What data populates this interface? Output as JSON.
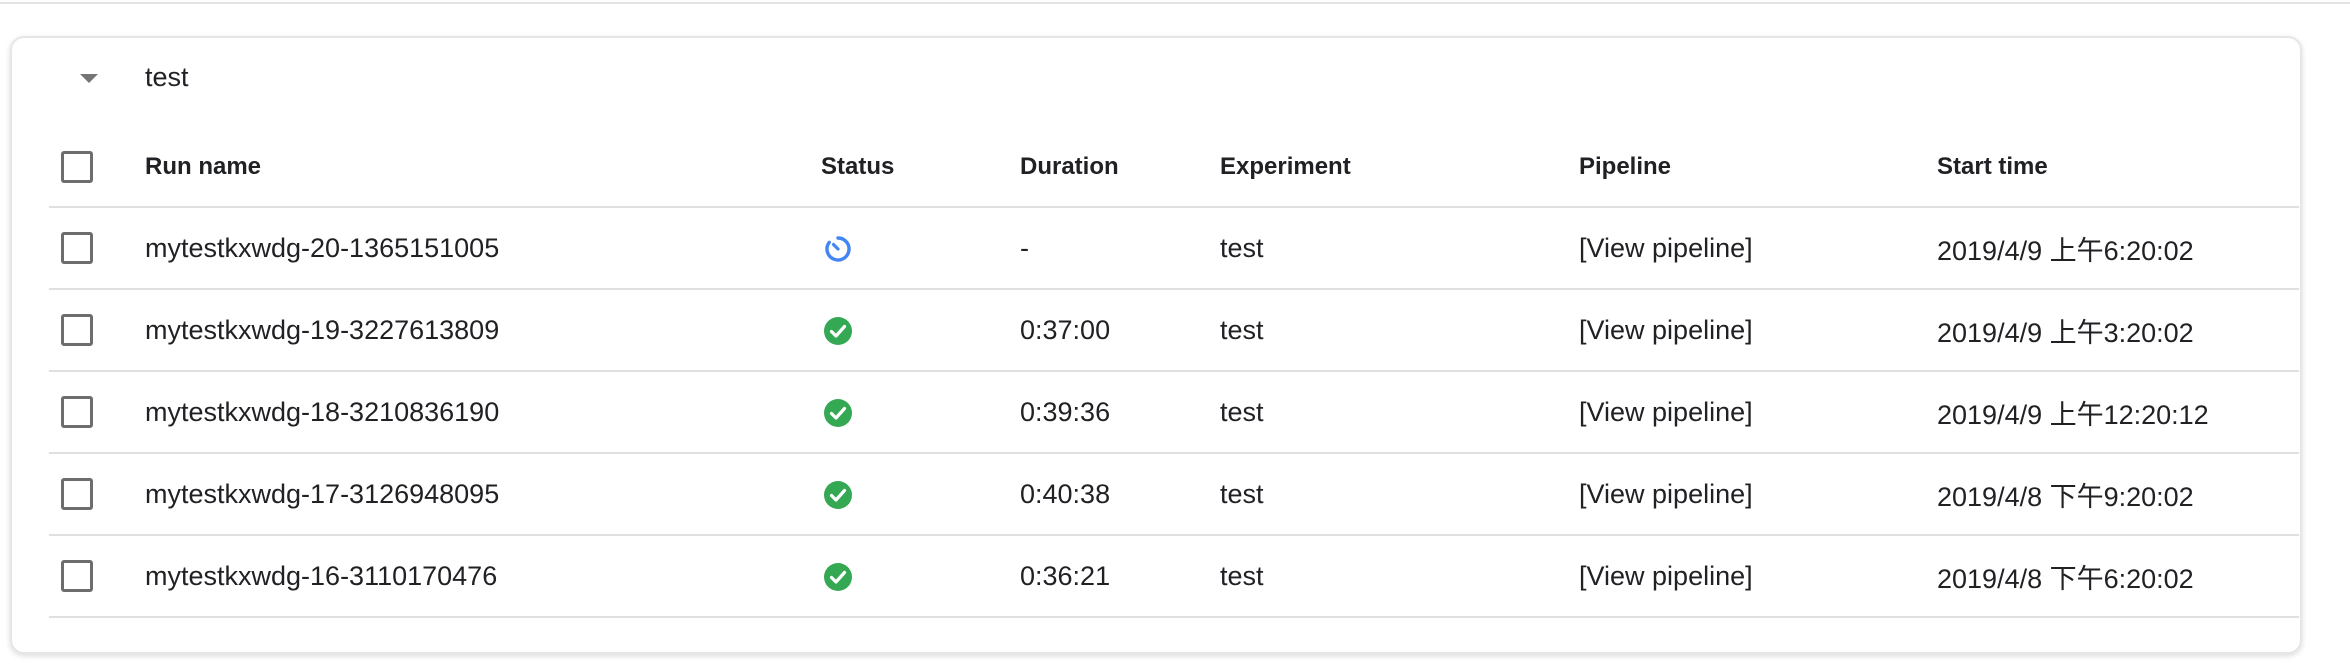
{
  "group": {
    "title": "test"
  },
  "columns": {
    "run_name": "Run name",
    "status": "Status",
    "duration": "Duration",
    "experiment": "Experiment",
    "pipeline": "Pipeline",
    "start_time": "Start time"
  },
  "colors": {
    "success": "#34a853",
    "running": "#4285f4"
  },
  "rows": [
    {
      "run_name": "mytestkxwdg-20-1365151005",
      "status_icon": "running-icon",
      "duration": "-",
      "experiment": "test",
      "pipeline": "[View pipeline]",
      "start_time": "2019/4/9 上午6:20:02"
    },
    {
      "run_name": "mytestkxwdg-19-3227613809",
      "status_icon": "success-check-icon",
      "duration": "0:37:00",
      "experiment": "test",
      "pipeline": "[View pipeline]",
      "start_time": "2019/4/9 上午3:20:02"
    },
    {
      "run_name": "mytestkxwdg-18-3210836190",
      "status_icon": "success-check-icon",
      "duration": "0:39:36",
      "experiment": "test",
      "pipeline": "[View pipeline]",
      "start_time": "2019/4/9 上午12:20:12"
    },
    {
      "run_name": "mytestkxwdg-17-3126948095",
      "status_icon": "success-check-icon",
      "duration": "0:40:38",
      "experiment": "test",
      "pipeline": "[View pipeline]",
      "start_time": "2019/4/8 下午9:20:02"
    },
    {
      "run_name": "mytestkxwdg-16-3110170476",
      "status_icon": "success-check-icon",
      "duration": "0:36:21",
      "experiment": "test",
      "pipeline": "[View pipeline]",
      "start_time": "2019/4/8 下午6:20:02"
    }
  ]
}
